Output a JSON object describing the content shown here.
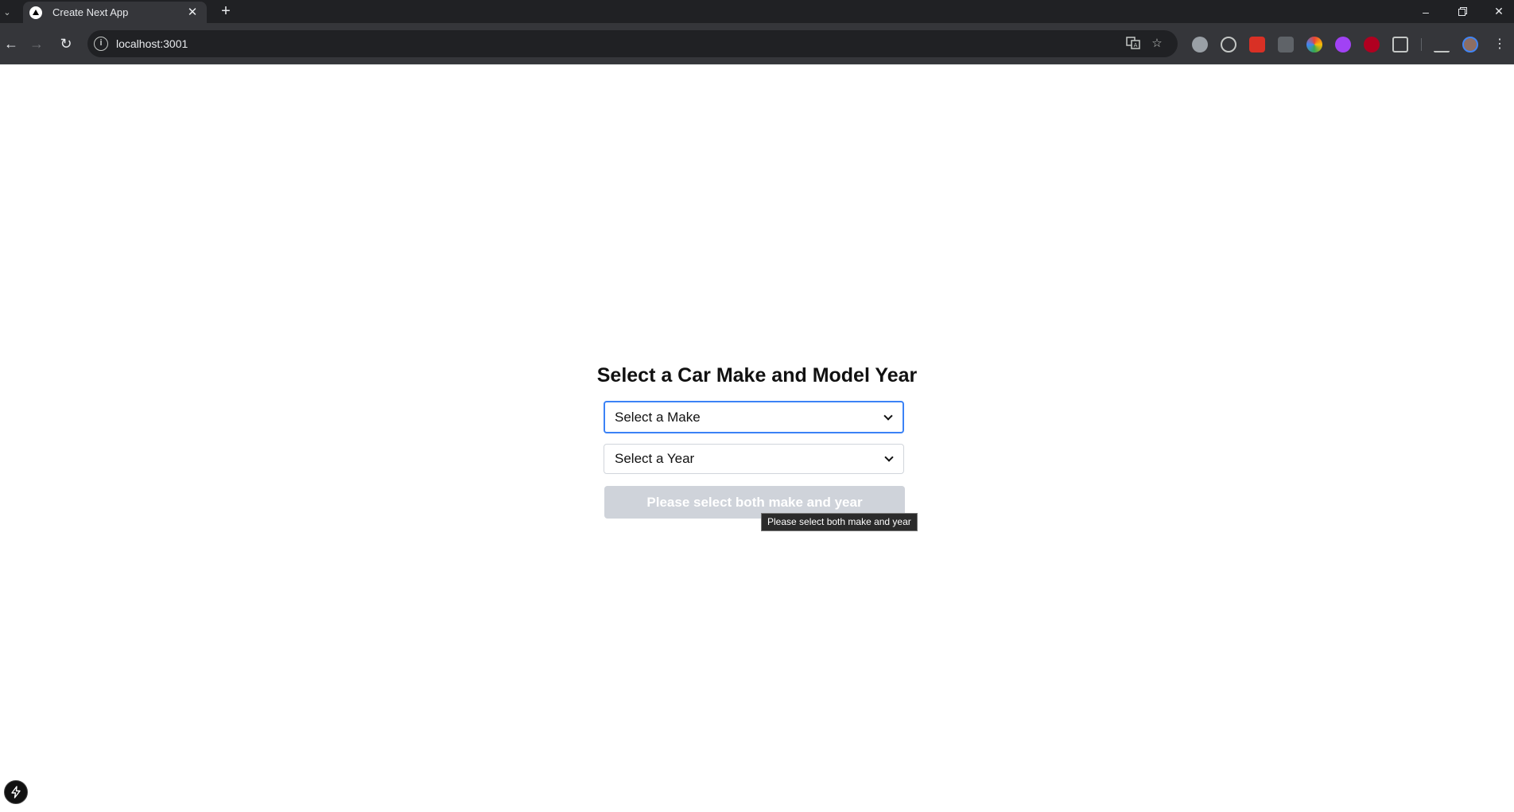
{
  "browser": {
    "tab_title": "Create Next App",
    "url": "localhost:3001",
    "new_tab_symbol": "+",
    "close_symbol": "✕"
  },
  "page": {
    "heading": "Select a Car Make and Model Year",
    "make_select": {
      "selected": "Select a Make"
    },
    "year_select": {
      "selected": "Select a Year"
    },
    "submit_button": {
      "label": "Please select both make and year",
      "disabled": true
    },
    "tooltip": "Please select both make and year"
  },
  "colors": {
    "focus_ring": "#3b82f6",
    "button_disabled_bg": "#cfd3da",
    "chrome_dark": "#202124",
    "chrome_toolbar": "#35363a"
  },
  "icons": {
    "extensions": [
      "grammar-extension-icon",
      "target-extension-icon",
      "red-extension-icon",
      "code-extension-icon",
      "colorful-extension-icon",
      "purple-extension-icon",
      "ublock-extension-icon",
      "puzzle-extensions-icon"
    ]
  }
}
